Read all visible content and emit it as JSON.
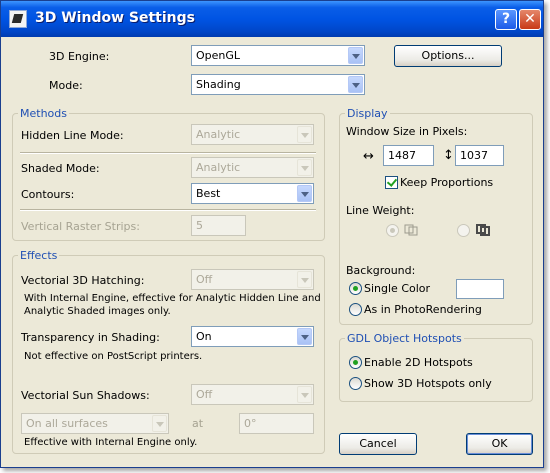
{
  "window": {
    "title": "3D Window Settings",
    "help_label": "?",
    "close_label": "✕"
  },
  "engine": {
    "label": "3D Engine:",
    "value": "OpenGL",
    "options_label": "Options..."
  },
  "mode": {
    "label": "Mode:",
    "value": "Shading"
  },
  "methods": {
    "title": "Methods",
    "hidden_line_label": "Hidden Line Mode:",
    "hidden_line_value": "Analytic",
    "shaded_label": "Shaded Mode:",
    "shaded_value": "Analytic",
    "contours_label": "Contours:",
    "contours_value": "Best",
    "raster_label": "Vertical Raster Strips:",
    "raster_value": "5"
  },
  "effects": {
    "title": "Effects",
    "hatching_label": "Vectorial 3D Hatching:",
    "hatching_value": "Off",
    "hatching_note_1": "With Internal Engine, effective for Analytic Hidden Line and",
    "hatching_note_2": "Analytic Shaded images only.",
    "transparency_label": "Transparency in Shading:",
    "transparency_value": "On",
    "transparency_note": "Not effective on PostScript printers.",
    "sun_label": "Vectorial Sun Shadows:",
    "sun_value": "Off",
    "surfaces_value": "On all surfaces",
    "at_label": "at",
    "angle_value": "0°",
    "sun_note": "Effective with Internal Engine only."
  },
  "display": {
    "title": "Display",
    "window_size_label": "Window Size in Pixels:",
    "width_icon": "↔",
    "width_value": "1487",
    "height_icon": "↕",
    "height_value": "1037",
    "keep_proportions_label": "Keep Proportions",
    "line_weight_label": "Line Weight:",
    "background_label": "Background:",
    "single_color_label": "Single Color",
    "photorendering_label": "As in PhotoRendering"
  },
  "hotspots": {
    "title": "GDL Object Hotspots",
    "enable_2d_label": "Enable 2D Hotspots",
    "show_3d_label": "Show 3D Hotspots only"
  },
  "footer": {
    "cancel_label": "Cancel",
    "ok_label": "OK"
  }
}
